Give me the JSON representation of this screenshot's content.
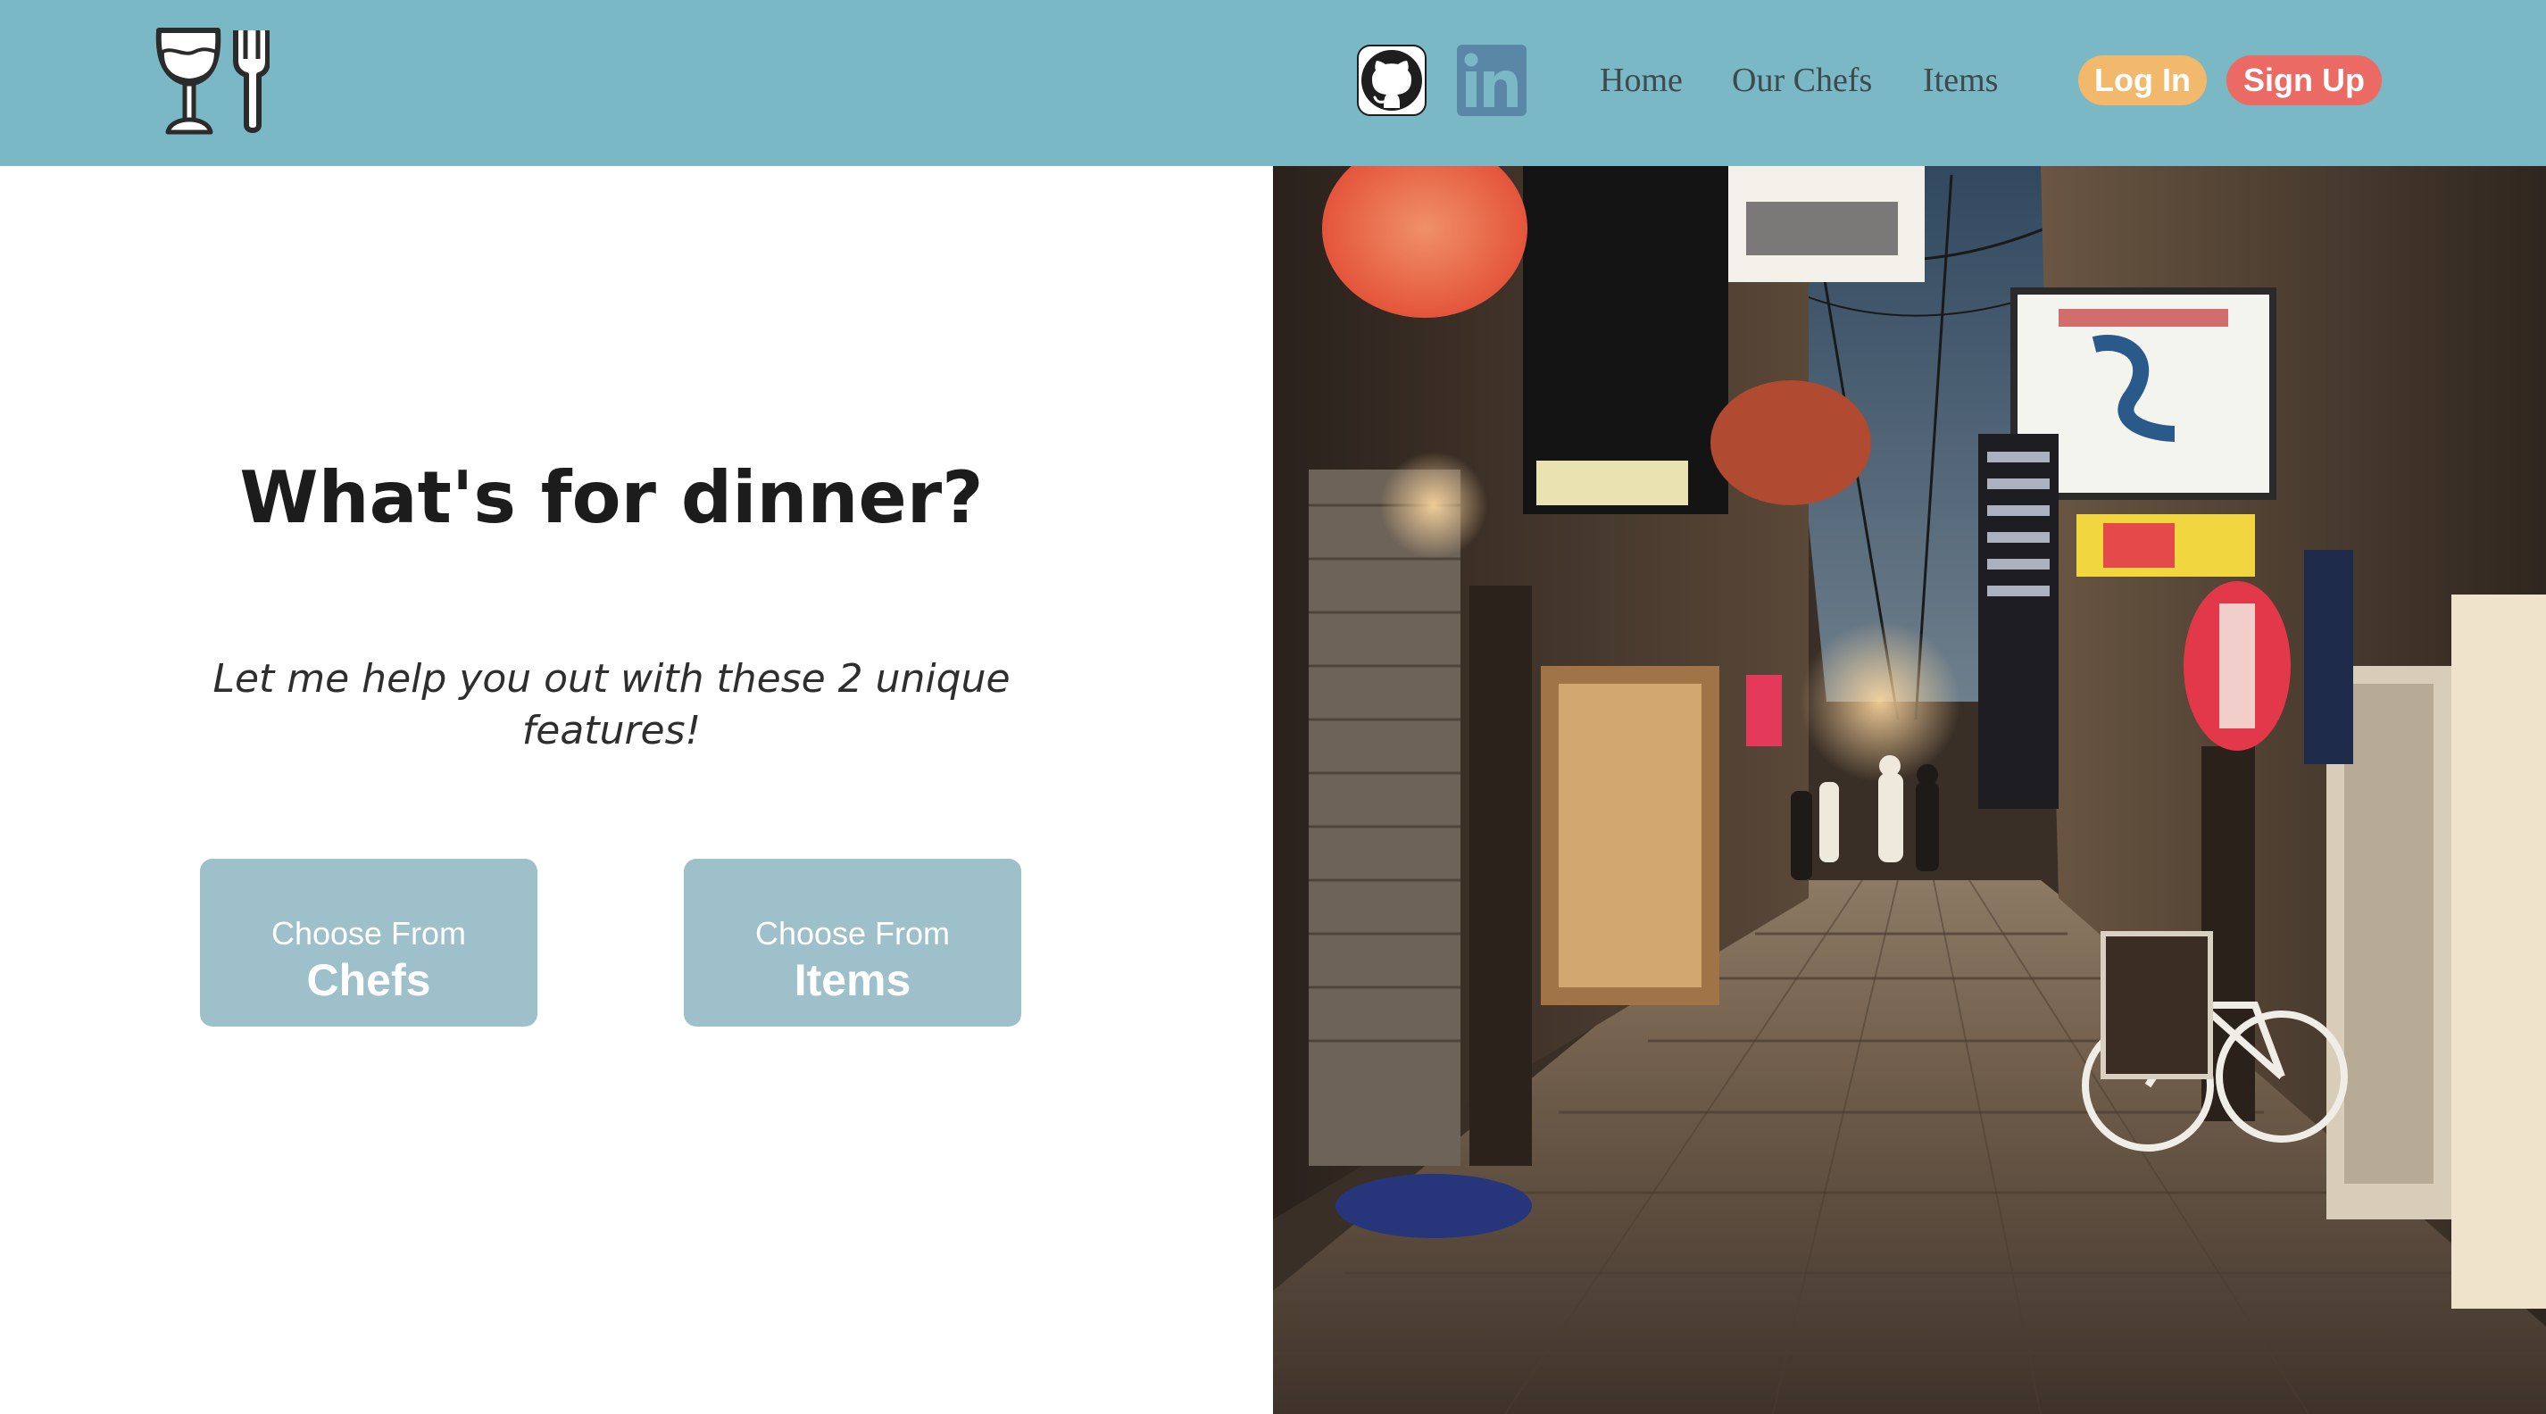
{
  "header": {
    "logo_icon": "wine-glass-and-fork-icon",
    "social": [
      {
        "icon": "github-icon",
        "label": "GitHub"
      },
      {
        "icon": "linkedin-icon",
        "label": "LinkedIn"
      }
    ],
    "nav": {
      "home": "Home",
      "chefs": "Our Chefs",
      "items": "Items"
    },
    "login": "Log In",
    "signup": "Sign Up",
    "colors": {
      "navbar": "#79b8c4",
      "login": "#f2b86b",
      "signup": "#ec6a64"
    }
  },
  "main": {
    "headline": "What's for dinner?",
    "subtitle": "Let me help you out with these 2 unique features!",
    "buttons": [
      {
        "small": "Choose From",
        "big": "Chefs"
      },
      {
        "small": "Choose From",
        "big": "Items"
      }
    ],
    "button_color": "#9ec0ca"
  },
  "hero": {
    "image_icon": "night-alley-photo"
  }
}
